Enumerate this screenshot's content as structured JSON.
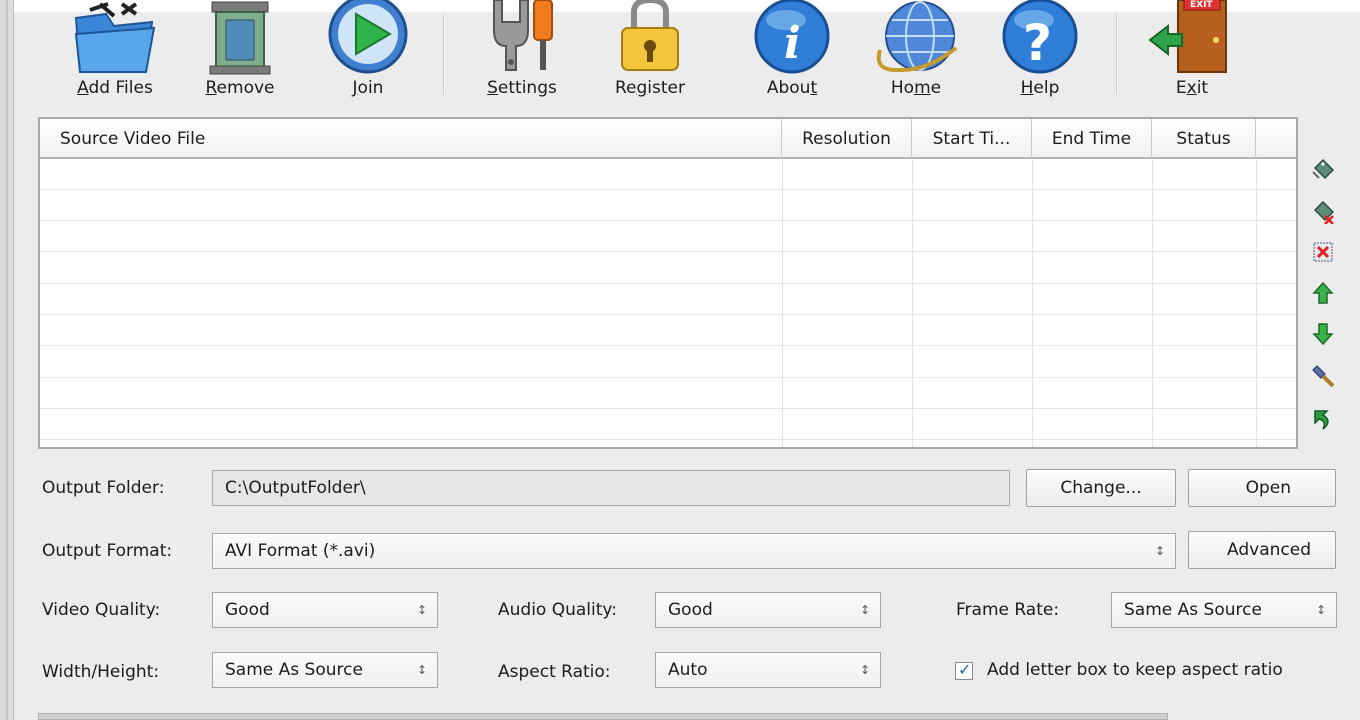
{
  "toolbar": {
    "add_files": {
      "pre": "",
      "key": "A",
      "post": "dd Files"
    },
    "remove": {
      "pre": "",
      "key": "R",
      "post": "emove"
    },
    "join": {
      "pre": "",
      "key": "J",
      "post": "oin"
    },
    "settings": {
      "pre": "",
      "key": "S",
      "post": "ettings"
    },
    "register": {
      "pre": "Re",
      "key": "g",
      "post": "ister"
    },
    "about": {
      "pre": "Abou",
      "key": "t",
      "post": ""
    },
    "home": {
      "pre": "Ho",
      "key": "m",
      "post": "e"
    },
    "help": {
      "pre": "",
      "key": "H",
      "post": "elp"
    },
    "exit": {
      "pre": "E",
      "key": "x",
      "post": "it"
    }
  },
  "list": {
    "columns": [
      "Source Video File",
      "Resolution",
      "Start Ti...",
      "End Time",
      "Status"
    ],
    "rows": []
  },
  "output": {
    "folder_label": "Output Folder:",
    "folder_value": "C:\\OutputFolder\\",
    "change_label": "Change...",
    "open_label": "Open",
    "format_label": "Output Format:",
    "format_value": "AVI Format (*.avi)",
    "advanced_label": "Advanced"
  },
  "options": {
    "video_quality_label": "Video Quality:",
    "video_quality_value": "Good",
    "audio_quality_label": "Audio Quality:",
    "audio_quality_value": "Good",
    "frame_rate_label": "Frame Rate:",
    "frame_rate_value": "Same As Source",
    "width_height_label": "Width/Height:",
    "width_height_value": "Same As Source",
    "aspect_ratio_label": "Aspect Ratio:",
    "aspect_ratio_value": "Auto",
    "letterbox_label": "Add letter box to keep aspect ratio",
    "letterbox_checked": true
  },
  "icons": {
    "toolbar": [
      "add-files-icon",
      "remove-icon",
      "join-icon",
      "settings-icon",
      "register-icon",
      "about-icon",
      "home-icon",
      "help-icon",
      "exit-icon"
    ],
    "side": [
      "tag-icon",
      "tag-remove-icon",
      "delete-all-icon",
      "move-up-icon",
      "move-down-icon",
      "edit-icon",
      "refresh-icon"
    ]
  },
  "colors": {
    "window_bg": "#ececec",
    "list_bg": "#ffffff",
    "field_bg": "#e6e6e6"
  },
  "select_arrow": "↕"
}
